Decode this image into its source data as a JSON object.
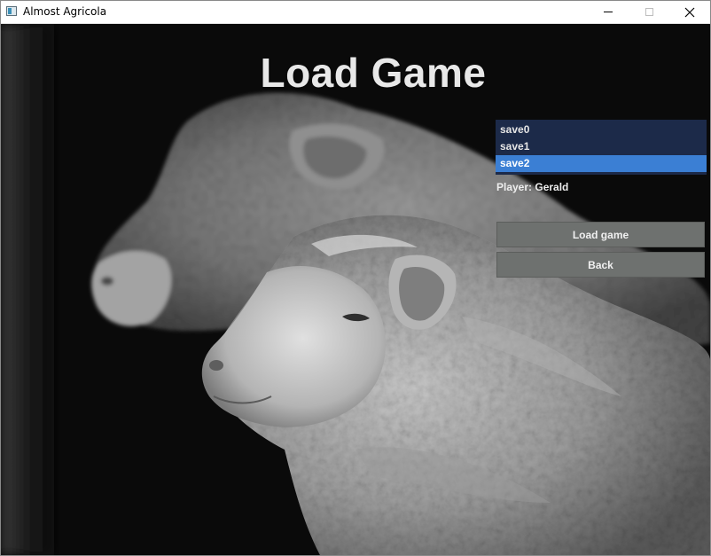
{
  "window": {
    "title": "Almost Agricola",
    "icon": "app-window-icon",
    "controls": [
      "minimize-icon",
      "maximize-icon",
      "close-icon"
    ]
  },
  "screen": {
    "heading": "Load Game",
    "background": "grayscale photo of two sheep"
  },
  "saves": {
    "items": [
      {
        "label": "save0",
        "selected": false
      },
      {
        "label": "save1",
        "selected": false
      },
      {
        "label": "save2",
        "selected": true
      }
    ],
    "list_bg": "#1c2a49",
    "selected_bg": "#3b7fd4"
  },
  "player": {
    "label": "Player: Gerald"
  },
  "buttons": {
    "load_label": "Load game",
    "back_label": "Back",
    "bg": "#6e716f"
  }
}
